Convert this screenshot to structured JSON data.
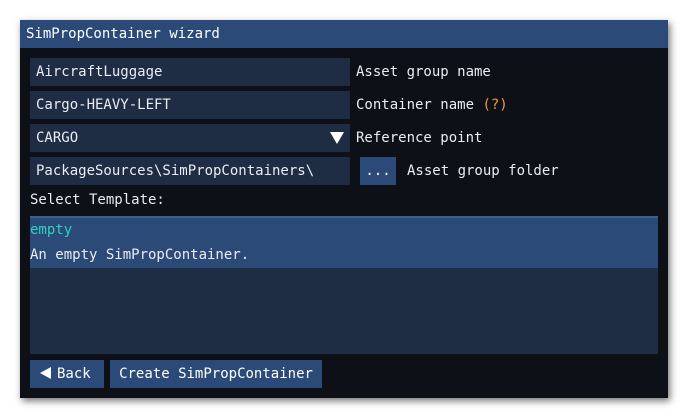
{
  "window": {
    "title": "SimPropContainer wizard"
  },
  "form": {
    "asset_group_name": {
      "value": "AircraftLuggage",
      "label": "Asset group name"
    },
    "container_name": {
      "value": "Cargo-HEAVY-LEFT",
      "label": "Container name",
      "hint": "(?)"
    },
    "reference_point": {
      "selected": "CARGO",
      "label": "Reference point"
    },
    "asset_group_folder": {
      "value": "PackageSources\\SimPropContainers\\",
      "browse_label": "...",
      "label": "Asset group folder"
    }
  },
  "templates": {
    "heading": "Select Template:",
    "items": [
      {
        "name": "empty",
        "description": "An empty SimPropContainer."
      }
    ]
  },
  "footer": {
    "back_label": "Back",
    "create_label": "Create SimPropContainer"
  },
  "colors": {
    "accent": "#2c4a78",
    "field_bg": "#1f2d44",
    "window_bg": "#0d1016",
    "template_name": "#2fd0c0",
    "hint": "#f09a3a"
  }
}
